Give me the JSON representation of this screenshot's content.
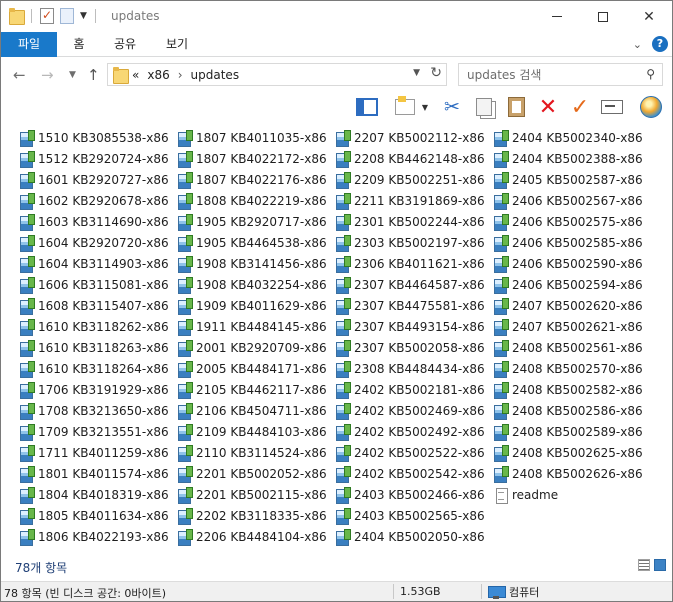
{
  "window": {
    "title": "updates",
    "controls": {
      "minimize": "minimize",
      "maximize": "maximize",
      "close": "✕"
    }
  },
  "ribbon": {
    "tabs": [
      "파일",
      "홈",
      "공유",
      "보기"
    ],
    "help_label": "?",
    "collapse_glyph": "⌄"
  },
  "address": {
    "overflow": "«",
    "crumbs": [
      "x86",
      "updates"
    ],
    "separator": "›"
  },
  "search": {
    "placeholder": "updates 검색"
  },
  "toolbar": {
    "buttons": [
      "layout-icon",
      "view-options-icon",
      "cut-icon",
      "copy-icon",
      "paste-icon",
      "delete-icon",
      "properties-check-icon",
      "rename-icon",
      "shell-icon"
    ],
    "colors": {
      "delete": "#e3161e",
      "check": "#e56a1b",
      "accent": "#1979ca"
    }
  },
  "files": {
    "col1": [
      "1510 KB3085538-x86",
      "1512 KB2920724-x86",
      "1601 KB2920727-x86",
      "1602 KB2920678-x86",
      "1603 KB3114690-x86",
      "1604 KB2920720-x86",
      "1604 KB3114903-x86",
      "1606 KB3115081-x86",
      "1608 KB3115407-x86",
      "1610 KB3118262-x86",
      "1610 KB3118263-x86",
      "1610 KB3118264-x86",
      "1706 KB3191929-x86",
      "1708 KB3213650-x86",
      "1709 KB3213551-x86",
      "1711 KB4011259-x86",
      "1801 KB4011574-x86",
      "1804 KB4018319-x86",
      "1805 KB4011634-x86",
      "1806 KB4022193-x86"
    ],
    "col2": [
      "1807 KB4011035-x86",
      "1807 KB4022172-x86",
      "1807 KB4022176-x86",
      "1808 KB4022219-x86",
      "1905 KB2920717-x86",
      "1905 KB4464538-x86",
      "1908 KB3141456-x86",
      "1908 KB4032254-x86",
      "1909 KB4011629-x86",
      "1911 KB4484145-x86",
      "2001 KB2920709-x86",
      "2005 KB4484171-x86",
      "2105 KB4462117-x86",
      "2106 KB4504711-x86",
      "2109 KB4484103-x86",
      "2110 KB3114524-x86",
      "2201 KB5002052-x86",
      "2201 KB5002115-x86",
      "2202 KB3118335-x86",
      "2206 KB4484104-x86"
    ],
    "col3": [
      "2207 KB5002112-x86",
      "2208 KB4462148-x86",
      "2209 KB5002251-x86",
      "2211 KB3191869-x86",
      "2301 KB5002244-x86",
      "2303 KB5002197-x86",
      "2306 KB4011621-x86",
      "2307 KB4464587-x86",
      "2307 KB4475581-x86",
      "2307 KB4493154-x86",
      "2307 KB5002058-x86",
      "2308 KB4484434-x86",
      "2402 KB5002181-x86",
      "2402 KB5002469-x86",
      "2402 KB5002492-x86",
      "2402 KB5002522-x86",
      "2402 KB5002542-x86",
      "2403 KB5002466-x86",
      "2403 KB5002565-x86",
      "2404 KB5002050-x86"
    ],
    "col4": [
      "2404 KB5002340-x86",
      "2404 KB5002388-x86",
      "2405 KB5002587-x86",
      "2406 KB5002567-x86",
      "2406 KB5002575-x86",
      "2406 KB5002585-x86",
      "2406 KB5002590-x86",
      "2406 KB5002594-x86",
      "2407 KB5002620-x86",
      "2407 KB5002621-x86",
      "2408 KB5002561-x86",
      "2408 KB5002570-x86",
      "2408 KB5002582-x86",
      "2408 KB5002586-x86",
      "2408 KB5002589-x86",
      "2408 KB5002625-x86",
      "2408 KB5002626-x86",
      "readme"
    ]
  },
  "item_count": "78개 항목",
  "status": {
    "left": "78 항목 (빈 디스크 공간: 0바이트)",
    "size": "1.53GB",
    "location": "컴퓨터"
  }
}
